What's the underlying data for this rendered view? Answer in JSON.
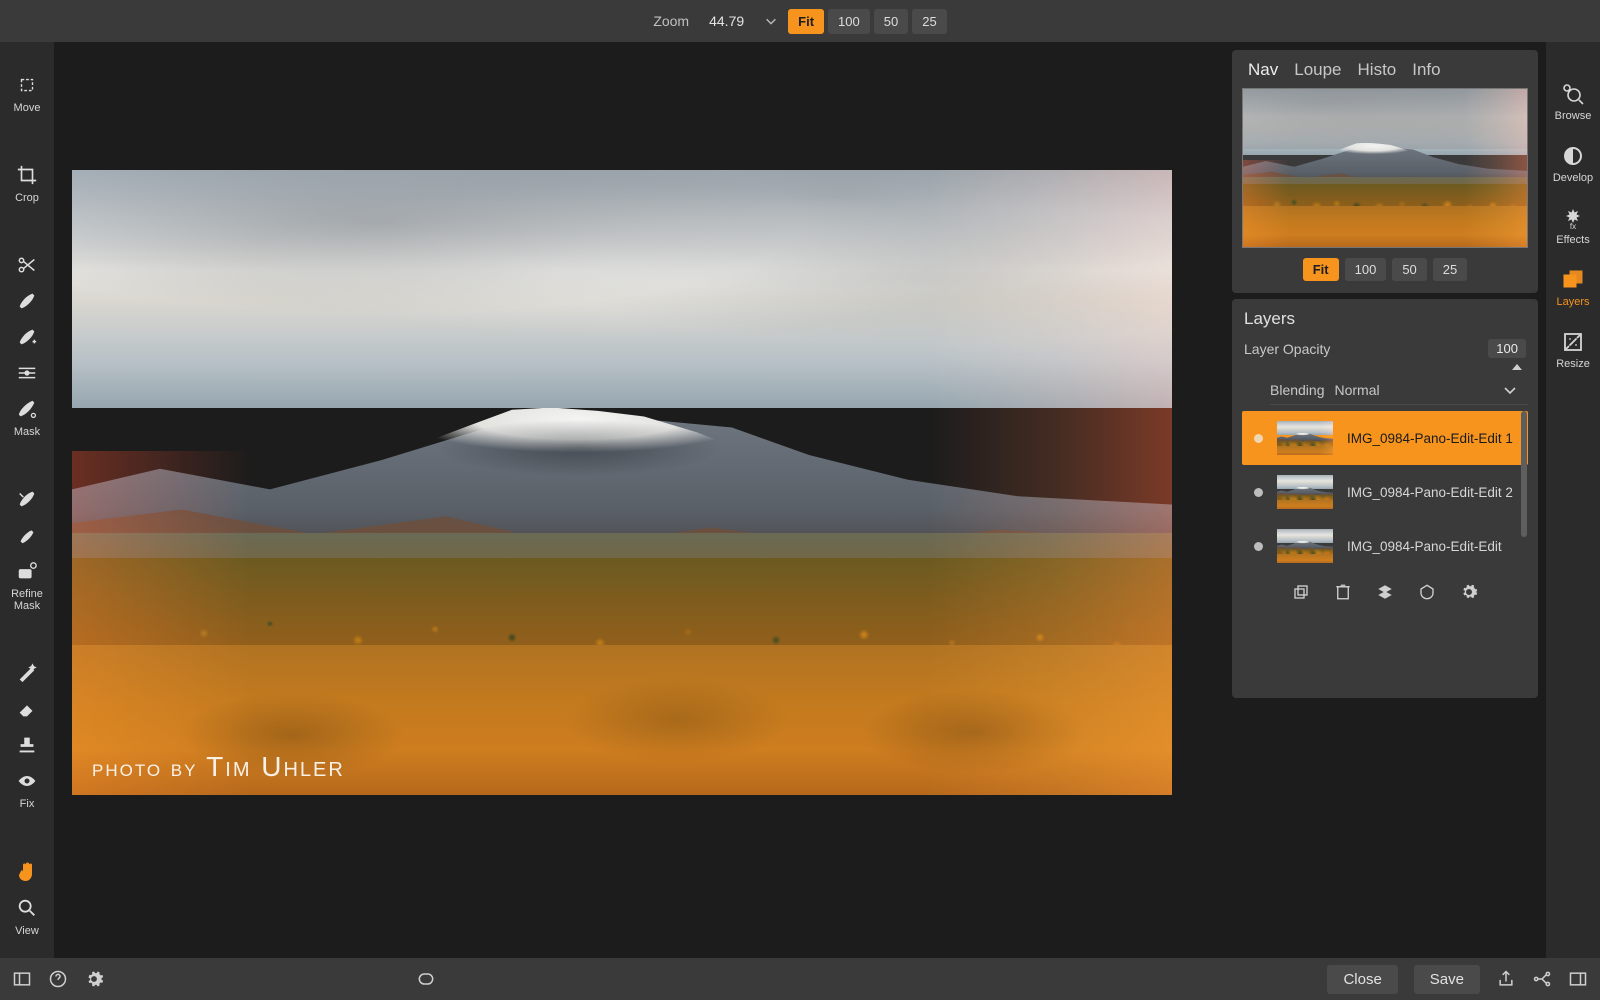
{
  "top": {
    "zoom_label": "Zoom",
    "zoom_value": "44.79",
    "buttons": [
      "Fit",
      "100",
      "50",
      "25"
    ],
    "active": "Fit"
  },
  "left_tools": [
    {
      "id": "move",
      "label": "Move"
    },
    {
      "id": "crop",
      "label": "Crop"
    },
    {
      "id": "brush1",
      "label": ""
    },
    {
      "id": "brush2",
      "label": ""
    },
    {
      "id": "level",
      "label": ""
    },
    {
      "id": "mask",
      "label": "Mask"
    },
    {
      "id": "healbrush",
      "label": ""
    },
    {
      "id": "brush3",
      "label": ""
    },
    {
      "id": "refine",
      "label": "Refine\nMask"
    },
    {
      "id": "wand",
      "label": ""
    },
    {
      "id": "eraser",
      "label": ""
    },
    {
      "id": "stamp",
      "label": ""
    },
    {
      "id": "eye",
      "label": "Fix"
    },
    {
      "id": "hand",
      "label": ""
    },
    {
      "id": "view",
      "label": "View"
    }
  ],
  "right_modes": [
    {
      "id": "browse",
      "label": "Browse"
    },
    {
      "id": "develop",
      "label": "Develop"
    },
    {
      "id": "effects",
      "label": "Effects"
    },
    {
      "id": "layers",
      "label": "Layers",
      "active": true
    },
    {
      "id": "resize",
      "label": "Resize"
    }
  ],
  "nav_panel": {
    "tabs": [
      "Nav",
      "Loupe",
      "Histo",
      "Info"
    ],
    "active": "Nav",
    "zoom_buttons": [
      "Fit",
      "100",
      "50",
      "25"
    ],
    "zoom_active": "Fit"
  },
  "layers_panel": {
    "title": "Layers",
    "opacity_label": "Layer Opacity",
    "opacity_value": "100",
    "blending_label": "Blending",
    "blending_value": "Normal",
    "layers": [
      {
        "name": "IMG_0984-Pano-Edit-Edit 1",
        "selected": true
      },
      {
        "name": "IMG_0984-Pano-Edit-Edit 2",
        "selected": false
      },
      {
        "name": "IMG_0984-Pano-Edit-Edit",
        "selected": false
      }
    ]
  },
  "photo": {
    "credit_prefix": "photo by ",
    "credit_name": "Tim Uhler"
  },
  "bottom": {
    "close": "Close",
    "save": "Save"
  }
}
